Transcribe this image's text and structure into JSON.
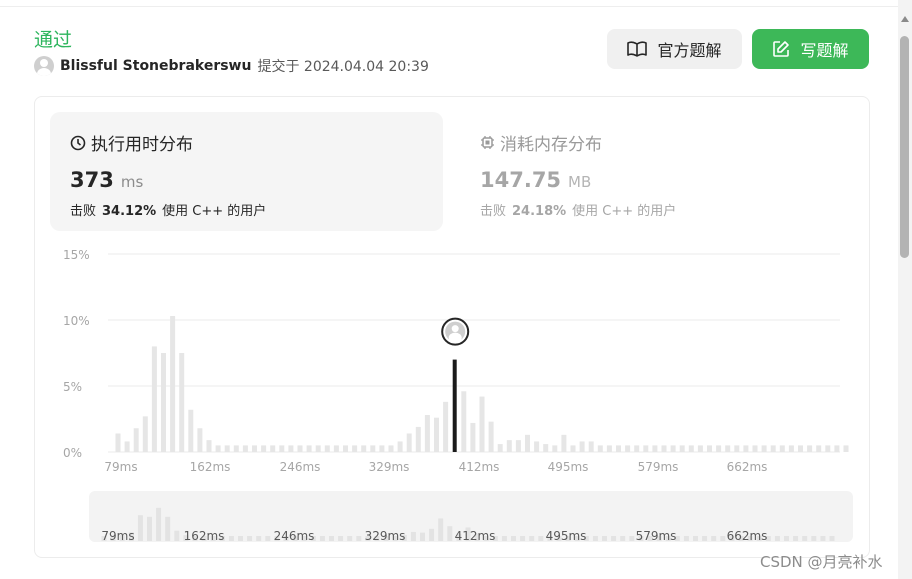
{
  "header": {
    "status": "通过",
    "username": "Blissful Stonebrakerswu",
    "submitted_text": "提交于 2024.04.04 20:39"
  },
  "buttons": {
    "official_solution": "官方题解",
    "write_solution": "写题解"
  },
  "tabs": {
    "runtime": {
      "title": "执行用时分布",
      "value": "373",
      "unit": "ms",
      "beats_prefix": "击败",
      "beats_pct": "34.12%",
      "beats_suffix": "使用 C++ 的用户"
    },
    "memory": {
      "title": "消耗内存分布",
      "value": "147.75",
      "unit": "MB",
      "beats_prefix": "击败",
      "beats_pct": "24.18%",
      "beats_suffix": "使用 C++ 的用户"
    }
  },
  "colors": {
    "accent_green": "#3db858",
    "status_green": "#2db55d",
    "bar": "#e6e6e6",
    "highlight_bar": "#1a1a1a"
  },
  "icons": {
    "book": "book-icon",
    "edit": "edit-icon",
    "clock": "clock-icon",
    "chip": "chip-icon"
  },
  "chart_data": {
    "type": "bar",
    "ylim": [
      0,
      15
    ],
    "y_ticks": [
      "15%",
      "10%",
      "5%",
      "0%"
    ],
    "x_tick_labels": [
      "79ms",
      "162ms",
      "246ms",
      "329ms",
      "412ms",
      "495ms",
      "579ms",
      "662ms"
    ],
    "values": [
      1.4,
      0.8,
      1.8,
      2.7,
      8.0,
      7.5,
      10.3,
      7.5,
      3.2,
      1.8,
      0.9,
      0.5,
      0.5,
      0.5,
      0.5,
      0.5,
      0.5,
      0.5,
      0.5,
      0.5,
      0.5,
      0.5,
      0.5,
      0.5,
      0.5,
      0.5,
      0.5,
      0.5,
      0.5,
      0.5,
      0.5,
      0.8,
      1.4,
      1.9,
      2.8,
      2.6,
      3.8,
      7.0,
      4.6,
      2.2,
      4.2,
      2.3,
      0.6,
      0.9,
      0.9,
      1.3,
      0.8,
      0.6,
      0.5,
      1.3,
      0.5,
      0.8,
      0.8,
      0.5,
      0.5,
      0.5,
      0.5,
      0.5,
      0.5,
      0.5,
      0.5,
      0.5,
      0.5,
      0.5,
      0.5,
      0.5,
      0.5,
      0.5,
      0.5,
      0.5,
      0.5,
      0.5,
      0.5,
      0.5,
      0.5,
      0.5,
      0.5,
      0.5,
      0.5,
      0.5,
      0.5
    ],
    "highlight_index": 37
  },
  "mini_chart": {
    "x_tick_labels": [
      "79ms",
      "162ms",
      "246ms",
      "329ms",
      "412ms",
      "495ms",
      "579ms",
      "662ms"
    ]
  },
  "watermark": "CSDN @月亮补水"
}
